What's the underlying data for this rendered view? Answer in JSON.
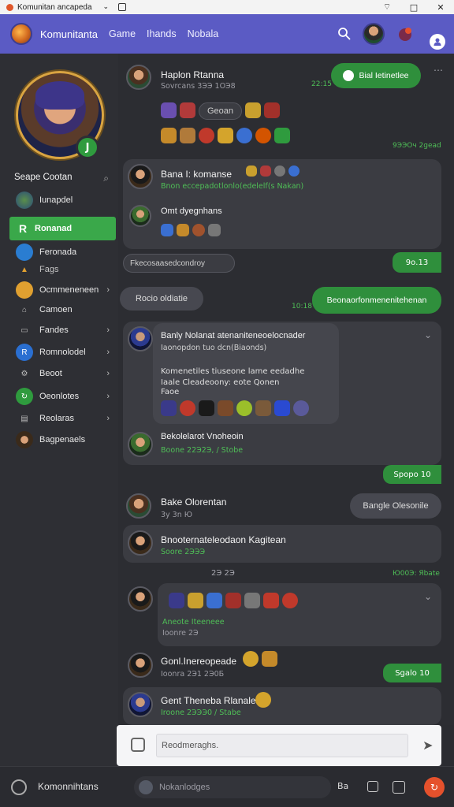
{
  "os": {
    "title": "Komunitan ancapeda",
    "controls": [
      "⌵",
      "□",
      "✕"
    ]
  },
  "header": {
    "brand": "Komunitanta",
    "nav": [
      "Game",
      "Ihands",
      "Nobala"
    ],
    "icons": [
      "search-icon",
      "avatar",
      "notification-icon",
      "profile-icon"
    ]
  },
  "sidebar": {
    "search_label": "Seape Cootan",
    "items": [
      {
        "label": "Iunapdel",
        "icon_color": "#3f6b9a"
      },
      {
        "label": "Ronanad",
        "icon_color": "#ffffff",
        "active": true
      },
      {
        "label": "Feronada",
        "icon_color": "#2a7dd1"
      },
      {
        "label": "Fags",
        "icon_color": ""
      },
      {
        "label": "Ocmmeneneen",
        "icon_color": "#e0a030"
      },
      {
        "label": "Camoen",
        "icon_color": "#555"
      },
      {
        "label": "Fandes",
        "icon_color": "#555"
      },
      {
        "label": "Romnolodel",
        "icon_color": "#2a6fd1"
      },
      {
        "label": "Beoot",
        "icon_color": "#555"
      },
      {
        "label": "Oeonlotes",
        "icon_color": "#2f9b3e"
      },
      {
        "label": "Reolaras",
        "icon_color": "#555"
      },
      {
        "label": "Bagpenaels",
        "icon_color": "#a0522d"
      }
    ],
    "badge_icon": "J"
  },
  "chat": {
    "m1": {
      "name": "Haplon Rtanna",
      "sub": "Sovrcans 3ЭЭ 1ОЭ8",
      "emote_label": "Geoan",
      "time": "22:15",
      "footer": "9ЭЭОч 2gead"
    },
    "pill_top": "Bial Ietinetlee",
    "m2": {
      "name": "Bana I: komanse",
      "green": "Bnon eccepadotlonlo(edelelf(s Nakan)",
      "line2": "Omt dyegnhans",
      "time": "9о.13"
    },
    "m2_pill": "Fkecosaasedcondroy",
    "sys_left": "Rocio oldiatie",
    "sys_time": "10:18",
    "sys_right": "Beonaorfonmenenitehenan",
    "m3": {
      "name": "Banly Nolanat  atenaniteneoelocnader",
      "line2": "Iaonopdon tuo dcn(Biaonds)",
      "line3": "Komenetiles tiuseone lame eedadhe",
      "line4": "Iaale Cleadeoony: eote Qonen",
      "line5": "Faoe"
    },
    "m4": {
      "name": "Bekolelarot Vnoheoin",
      "green": "Boone 22Э2Э, / Stobe",
      "time": "Spopo 10"
    },
    "m5": {
      "name": "Bake Olorentan",
      "sub": "3y 3n Ю"
    },
    "m5_pill": "Bangle Olesonile",
    "m6": {
      "name": "Bnooternateleodaon Kagitean",
      "green": "Soore 2ЭЭЭ"
    },
    "center_time": "2Э 2Э",
    "m7": {
      "green": "Aneote Iteeneee",
      "sub": "Ioonre 2Э",
      "footer": "Ю00Э: Яbate"
    },
    "m8": {
      "name": "Gonl.Inereopeade",
      "sub": "Ioonra 2Э1 2Э0Б",
      "time": "Sgalo 10"
    },
    "m9": {
      "name": "Gent Theneba Rlanale",
      "green": "Iroone 2ЭЭЭ0 / Stabe"
    }
  },
  "composer": {
    "placeholder": "Reodmeraghs."
  },
  "bottom": {
    "label": "Komonnihtans",
    "input": "Nokanlodges",
    "right1": "Ba",
    "orange_icon": "↻"
  }
}
